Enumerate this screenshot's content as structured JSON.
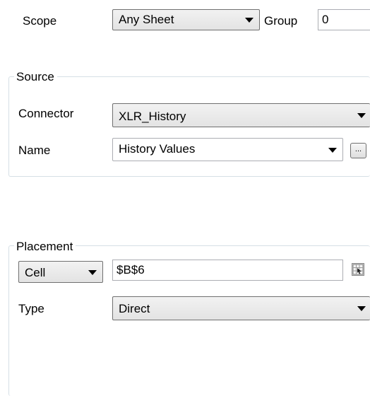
{
  "scope": {
    "label": "Scope",
    "value": "Any Sheet",
    "group_label": "Group",
    "group_value": "0"
  },
  "source": {
    "title": "Source",
    "connector_label": "Connector",
    "connector_value": "XLR_History",
    "name_label": "Name",
    "name_value": "History Values",
    "browse_label": "..."
  },
  "placement": {
    "title": "Placement",
    "mode_value": "Cell",
    "cell_value": "$B$6",
    "type_label": "Type",
    "type_value": "Direct"
  }
}
